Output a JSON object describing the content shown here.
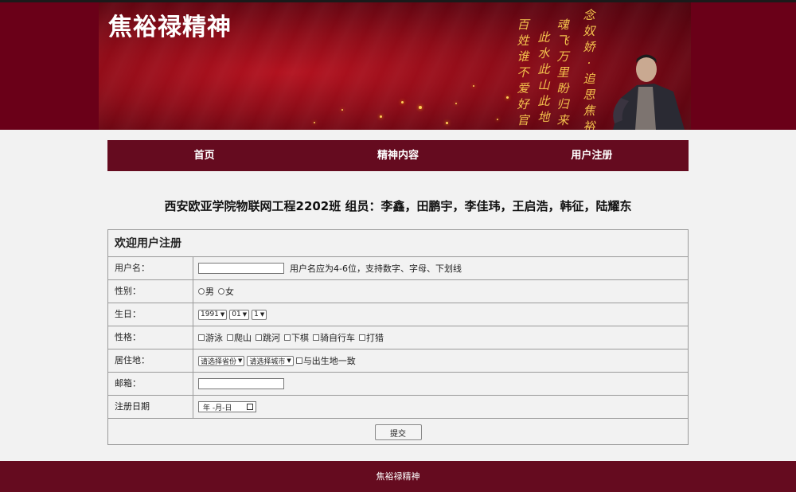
{
  "banner": {
    "title": "焦裕禄精神",
    "poem_columns": [
      "念奴娇·追思焦裕禄",
      "魂飞万里盼归来",
      "此水此山此地",
      "百姓谁不爱好官"
    ]
  },
  "nav": {
    "items": [
      "首页",
      "精神内容",
      "用户注册"
    ]
  },
  "team_line": "西安欧亚学院物联网工程2202班 组员：李鑫，田鹏宇，李佳玮，王启浩，韩征，陆耀东",
  "form": {
    "title": "欢迎用户注册",
    "username_label": "用户名：",
    "username_value": "",
    "username_hint": "用户名应为4-6位，支持数字、字母、下划线",
    "gender_label": "性别：",
    "gender_options": [
      "男",
      "女"
    ],
    "birthday_label": "生日：",
    "birth_year": "1991",
    "birth_month": "01",
    "birth_day": "1",
    "hobby_label": "性格：",
    "hobbies": [
      "游泳",
      "爬山",
      "跳河",
      "下棋",
      "骑自行车",
      "打猎"
    ],
    "residence_label": "居住地：",
    "province_select": "请选择省份",
    "city_select": "请选择城市",
    "same_as_birthplace": "与出生地一致",
    "email_label": "邮箱：",
    "email_value": "",
    "regdate_label": "注册日期",
    "regdate_placeholder": "年 -月-日",
    "submit_label": "提交"
  },
  "footer": {
    "text": "焦裕禄精神"
  },
  "colors": {
    "nav_bg": "#650b1f",
    "banner_red": "#8e0c18",
    "poem_gold": "#f3c24d",
    "page_bg": "#f2f2f2"
  }
}
